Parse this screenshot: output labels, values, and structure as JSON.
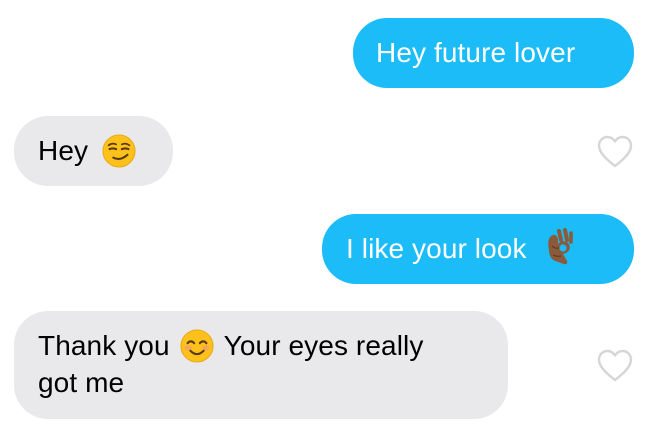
{
  "messages": [
    {
      "id": "msg1",
      "sender": "me",
      "text": "Hey future lover"
    },
    {
      "id": "msg2",
      "sender": "them",
      "text": "Hey",
      "emoji": "smirking-face"
    },
    {
      "id": "msg3",
      "sender": "me",
      "text": "I like your look",
      "emoji": "ok-hand-medium-dark"
    },
    {
      "id": "msg4",
      "sender": "them",
      "text_before": "Thank you",
      "emoji": "smiling-face-with-smiling-eyes",
      "text_after": "Your eyes really",
      "text_line2": "got me"
    }
  ],
  "icons": {
    "like": "heart-outline-icon"
  },
  "colors": {
    "sent_bubble": "#1bbcf7",
    "received_bubble": "#e9e9eb",
    "heart_outline": "#d6d6d8"
  }
}
